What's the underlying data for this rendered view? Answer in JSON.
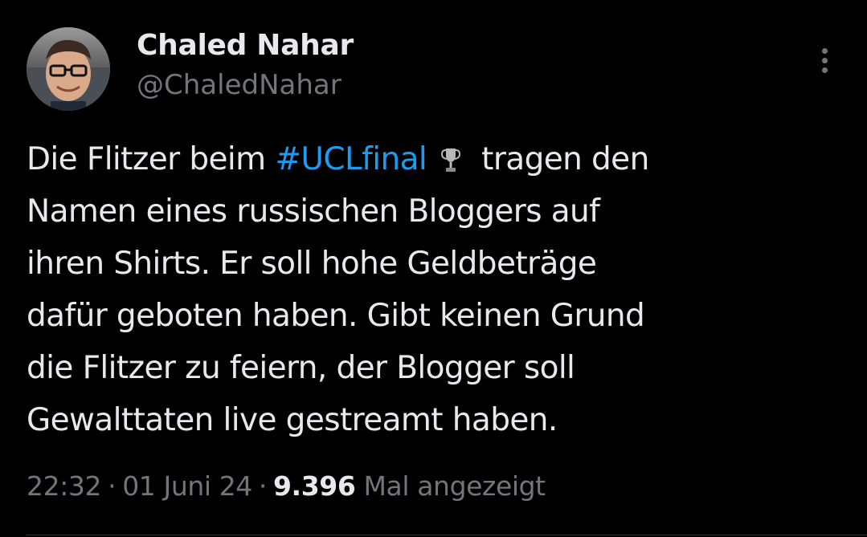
{
  "author": {
    "display_name": "Chaled Nahar",
    "handle": "@ChaledNahar"
  },
  "tweet": {
    "lines": [
      {
        "before": "Die Flitzer beim ",
        "hashtag": "#UCLfinal",
        "after": "tragen den"
      },
      "Namen eines russischen Bloggers auf",
      "ihren Shirts. Er soll hohe Geldbeträge",
      "dafür geboten haben. Gibt keinen Grund",
      "die Flitzer zu feiern, der Blogger soll",
      "Gewalttaten live gestreamt haben."
    ],
    "emoji_icon": "trophy-icon"
  },
  "meta": {
    "time": "22:32",
    "separator": "·",
    "date": "01 Juni 24",
    "views_count": "9.396",
    "views_label": "Mal angezeigt"
  },
  "colors": {
    "background": "#000000",
    "text": "#e7e9ea",
    "secondary": "#71767b",
    "link": "#1d9bf0"
  },
  "icons": {
    "more": "more-vertical-icon",
    "avatar": "avatar"
  }
}
